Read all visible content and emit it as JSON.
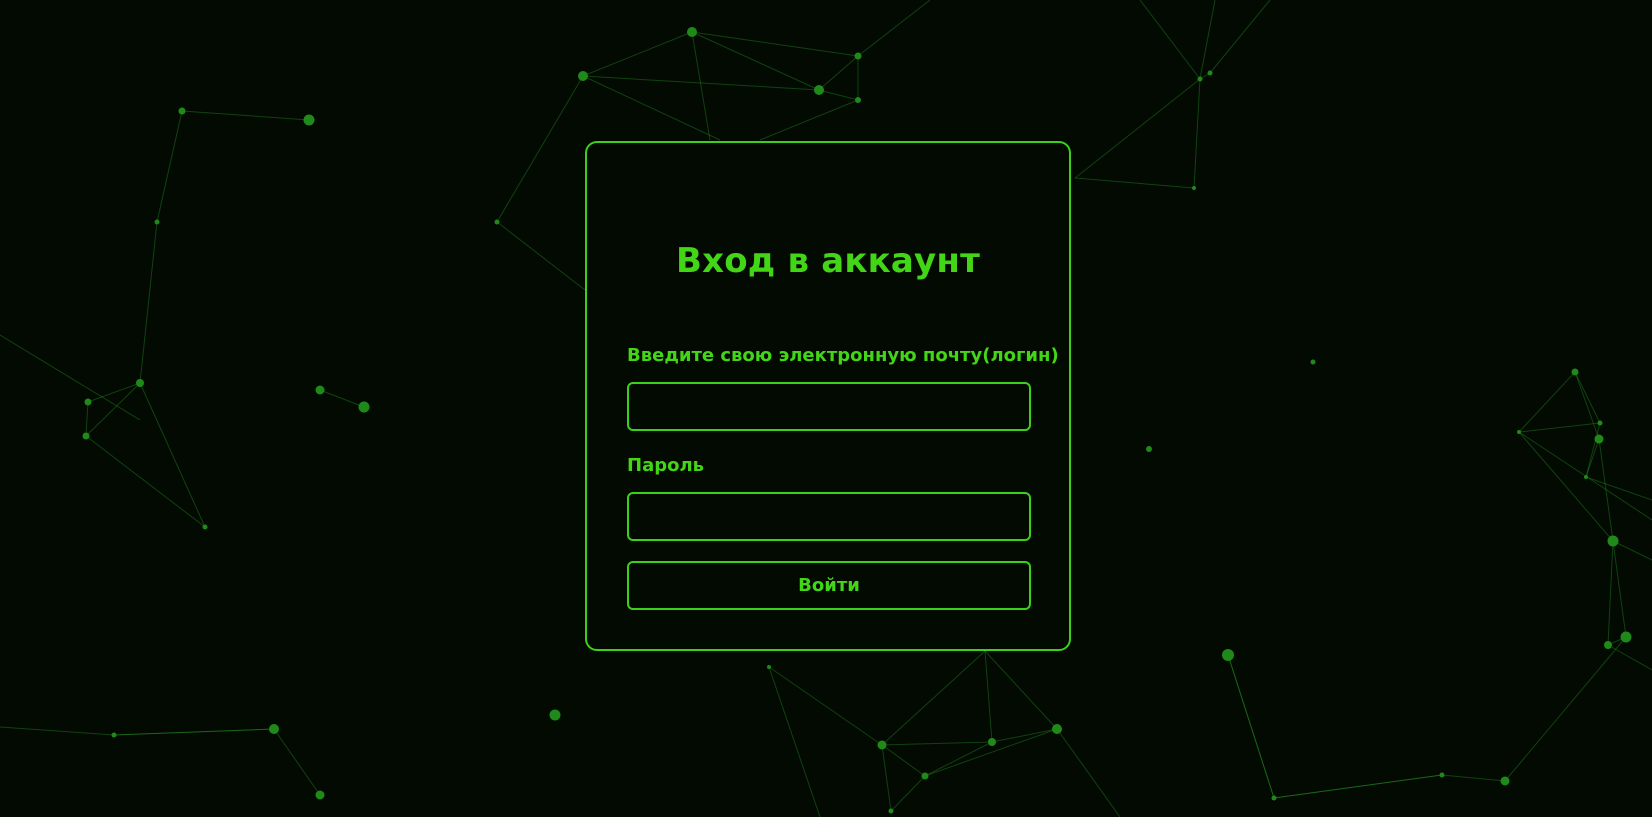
{
  "login": {
    "title": "Вход в аккаунт",
    "email_label": "Введите свою электронную почту(логин)",
    "email_value": "",
    "password_label": "Пароль",
    "password_value": "",
    "submit_label": "Войти"
  },
  "colors": {
    "background": "#020a02",
    "accent": "#43d617",
    "border": "#3bd11a",
    "network": "#1f8a19"
  }
}
